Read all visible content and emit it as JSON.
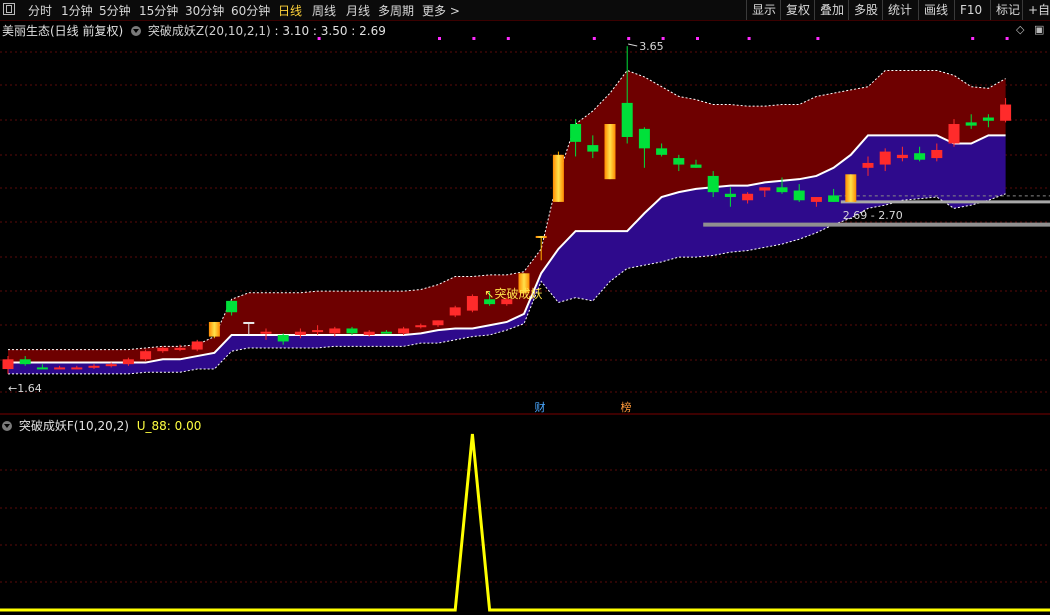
{
  "toolbar": {
    "periods": [
      "分时",
      "1分钟",
      "5分钟",
      "15分钟",
      "30分钟",
      "60分钟",
      "日线",
      "周线",
      "月线",
      "多周期",
      "更多 >"
    ],
    "active": "日线",
    "right_buttons": [
      "显示",
      "复权",
      "叠加",
      "多股",
      "统计",
      "画线",
      "F10",
      "标记",
      "+自选"
    ]
  },
  "main": {
    "stock_title": "美丽生态(日线 前复权)",
    "indicator_name": "突破成妖Z(20,10,2,1)",
    "indicator_values": ": 3.10 : 3.50 : 2.69",
    "max_label": "3.65",
    "min_label": "1.64",
    "range_label": "2.69 - 2.70",
    "signal_label": "突破成妖",
    "event_tags": [
      "财",
      "榜"
    ]
  },
  "sub": {
    "indicator_name": "突破成妖F(10,20,2)",
    "value_label": "U_88: 0.00"
  },
  "colors": {
    "up": "#ff2b2b",
    "down": "#00e03a",
    "highlight": "#ffb000",
    "upper_band": "#6e0000",
    "lower_band": "#2e0a8c",
    "mid_line": "#ffffff",
    "signal_line": "#ffff00"
  },
  "chart_data": [
    {
      "type": "candlestick",
      "price_range": [
        1.5,
        3.7
      ],
      "candles": [
        {
          "o": 1.66,
          "h": 1.74,
          "l": 1.63,
          "c": 1.72,
          "v": "up"
        },
        {
          "o": 1.72,
          "h": 1.74,
          "l": 1.68,
          "c": 1.69,
          "v": "down"
        },
        {
          "o": 1.67,
          "h": 1.69,
          "l": 1.66,
          "c": 1.66,
          "v": "down"
        },
        {
          "o": 1.67,
          "h": 1.68,
          "l": 1.66,
          "c": 1.67,
          "v": "up"
        },
        {
          "o": 1.67,
          "h": 1.68,
          "l": 1.66,
          "c": 1.67,
          "v": "up"
        },
        {
          "o": 1.67,
          "h": 1.69,
          "l": 1.66,
          "c": 1.68,
          "v": "up"
        },
        {
          "o": 1.68,
          "h": 1.7,
          "l": 1.67,
          "c": 1.69,
          "v": "up"
        },
        {
          "o": 1.69,
          "h": 1.73,
          "l": 1.68,
          "c": 1.72,
          "v": "up"
        },
        {
          "o": 1.72,
          "h": 1.78,
          "l": 1.71,
          "c": 1.77,
          "v": "up"
        },
        {
          "o": 1.77,
          "h": 1.8,
          "l": 1.76,
          "c": 1.79,
          "v": "up"
        },
        {
          "o": 1.79,
          "h": 1.81,
          "l": 1.77,
          "c": 1.78,
          "v": "up"
        },
        {
          "o": 1.78,
          "h": 1.84,
          "l": 1.77,
          "c": 1.83,
          "v": "up"
        },
        {
          "o": 1.86,
          "h": 1.95,
          "l": 1.85,
          "c": 1.95,
          "v": "limit"
        },
        {
          "o": 2.08,
          "h": 2.08,
          "l": 1.99,
          "c": 2.01,
          "v": "down"
        },
        {
          "o": 1.95,
          "h": 1.95,
          "l": 1.87,
          "c": 1.95,
          "v": "flat"
        },
        {
          "o": 1.88,
          "h": 1.91,
          "l": 1.84,
          "c": 1.89,
          "v": "up"
        },
        {
          "o": 1.87,
          "h": 1.88,
          "l": 1.81,
          "c": 1.83,
          "v": "down"
        },
        {
          "o": 1.87,
          "h": 1.91,
          "l": 1.85,
          "c": 1.89,
          "v": "up"
        },
        {
          "o": 1.89,
          "h": 1.93,
          "l": 1.87,
          "c": 1.9,
          "v": "up"
        },
        {
          "o": 1.88,
          "h": 1.92,
          "l": 1.86,
          "c": 1.91,
          "v": "up"
        },
        {
          "o": 1.91,
          "h": 1.92,
          "l": 1.87,
          "c": 1.88,
          "v": "down"
        },
        {
          "o": 1.87,
          "h": 1.9,
          "l": 1.86,
          "c": 1.89,
          "v": "up"
        },
        {
          "o": 1.89,
          "h": 1.9,
          "l": 1.88,
          "c": 1.88,
          "v": "down"
        },
        {
          "o": 1.88,
          "h": 1.92,
          "l": 1.87,
          "c": 1.91,
          "v": "up"
        },
        {
          "o": 1.92,
          "h": 1.94,
          "l": 1.91,
          "c": 1.93,
          "v": "up"
        },
        {
          "o": 1.93,
          "h": 1.96,
          "l": 1.92,
          "c": 1.96,
          "v": "up"
        },
        {
          "o": 1.99,
          "h": 2.05,
          "l": 1.98,
          "c": 2.04,
          "v": "up"
        },
        {
          "o": 2.02,
          "h": 2.12,
          "l": 2.01,
          "c": 2.11,
          "v": "up"
        },
        {
          "o": 2.09,
          "h": 2.14,
          "l": 2.05,
          "c": 2.06,
          "v": "down"
        },
        {
          "o": 2.06,
          "h": 2.1,
          "l": 2.05,
          "c": 2.09,
          "v": "up"
        },
        {
          "o": 2.13,
          "h": 2.25,
          "l": 2.12,
          "c": 2.25,
          "v": "limit"
        },
        {
          "o": 2.48,
          "h": 2.48,
          "l": 2.33,
          "c": 2.48,
          "v": "limit"
        },
        {
          "o": 2.69,
          "h": 3.0,
          "l": 2.69,
          "c": 2.98,
          "v": "limit"
        },
        {
          "o": 3.17,
          "h": 3.2,
          "l": 2.97,
          "c": 3.06,
          "v": "down"
        },
        {
          "o": 3.04,
          "h": 3.1,
          "l": 2.96,
          "c": 3.0,
          "v": "down"
        },
        {
          "o": 2.83,
          "h": 3.17,
          "l": 2.83,
          "c": 3.17,
          "v": "limit"
        },
        {
          "o": 3.3,
          "h": 3.65,
          "l": 3.05,
          "c": 3.09,
          "v": "down"
        },
        {
          "o": 3.14,
          "h": 3.15,
          "l": 2.9,
          "c": 3.02,
          "v": "down"
        },
        {
          "o": 3.02,
          "h": 3.05,
          "l": 2.97,
          "c": 2.98,
          "v": "down"
        },
        {
          "o": 2.96,
          "h": 2.98,
          "l": 2.88,
          "c": 2.92,
          "v": "down"
        },
        {
          "o": 2.92,
          "h": 2.95,
          "l": 2.9,
          "c": 2.9,
          "v": "down"
        },
        {
          "o": 2.85,
          "h": 2.88,
          "l": 2.72,
          "c": 2.75,
          "v": "down"
        },
        {
          "o": 2.74,
          "h": 2.78,
          "l": 2.66,
          "c": 2.72,
          "v": "down"
        },
        {
          "o": 2.7,
          "h": 2.75,
          "l": 2.68,
          "c": 2.74,
          "v": "up"
        },
        {
          "o": 2.76,
          "h": 2.78,
          "l": 2.72,
          "c": 2.78,
          "v": "up"
        },
        {
          "o": 2.78,
          "h": 2.84,
          "l": 2.74,
          "c": 2.75,
          "v": "down"
        },
        {
          "o": 2.76,
          "h": 2.8,
          "l": 2.69,
          "c": 2.7,
          "v": "down"
        },
        {
          "o": 2.69,
          "h": 2.72,
          "l": 2.66,
          "c": 2.72,
          "v": "up"
        },
        {
          "o": 2.69,
          "h": 2.77,
          "l": 2.69,
          "c": 2.73,
          "v": "down"
        },
        {
          "o": 2.69,
          "h": 2.86,
          "l": 2.69,
          "c": 2.86,
          "v": "limit"
        },
        {
          "o": 2.9,
          "h": 2.97,
          "l": 2.85,
          "c": 2.93,
          "v": "up"
        },
        {
          "o": 2.92,
          "h": 3.02,
          "l": 2.88,
          "c": 3.0,
          "v": "up"
        },
        {
          "o": 2.96,
          "h": 3.03,
          "l": 2.94,
          "c": 2.98,
          "v": "up"
        },
        {
          "o": 2.99,
          "h": 3.03,
          "l": 2.94,
          "c": 2.95,
          "v": "down"
        },
        {
          "o": 2.96,
          "h": 3.05,
          "l": 2.94,
          "c": 3.01,
          "v": "up"
        },
        {
          "o": 3.05,
          "h": 3.2,
          "l": 3.03,
          "c": 3.17,
          "v": "up"
        },
        {
          "o": 3.18,
          "h": 3.23,
          "l": 3.14,
          "c": 3.16,
          "v": "down"
        },
        {
          "o": 3.19,
          "h": 3.23,
          "l": 3.15,
          "c": 3.21,
          "v": "down"
        },
        {
          "o": 3.19,
          "h": 3.33,
          "l": 3.18,
          "c": 3.29,
          "v": "up"
        }
      ],
      "upper_band": [
        1.78,
        1.78,
        1.78,
        1.78,
        1.78,
        1.78,
        1.78,
        1.78,
        1.79,
        1.8,
        1.8,
        1.81,
        1.86,
        2.09,
        2.13,
        2.13,
        2.13,
        2.13,
        2.14,
        2.14,
        2.14,
        2.14,
        2.14,
        2.14,
        2.15,
        2.18,
        2.23,
        2.23,
        2.24,
        2.24,
        2.26,
        2.4,
        2.85,
        3.17,
        3.25,
        3.36,
        3.5,
        3.46,
        3.4,
        3.34,
        3.32,
        3.29,
        3.29,
        3.28,
        3.28,
        3.29,
        3.29,
        3.34,
        3.36,
        3.38,
        3.4,
        3.5,
        3.5,
        3.5,
        3.5,
        3.47,
        3.4,
        3.39,
        3.45
      ],
      "middle_line": [
        1.7,
        1.7,
        1.7,
        1.7,
        1.7,
        1.7,
        1.7,
        1.7,
        1.7,
        1.72,
        1.72,
        1.74,
        1.76,
        1.87,
        1.87,
        1.87,
        1.87,
        1.87,
        1.87,
        1.87,
        1.87,
        1.87,
        1.87,
        1.87,
        1.88,
        1.9,
        1.91,
        1.91,
        1.93,
        1.95,
        2.0,
        2.25,
        2.4,
        2.51,
        2.51,
        2.51,
        2.51,
        2.62,
        2.72,
        2.75,
        2.77,
        2.78,
        2.79,
        2.79,
        2.81,
        2.82,
        2.83,
        2.85,
        2.9,
        2.98,
        3.1,
        3.1,
        3.1,
        3.1,
        3.1,
        3.05,
        3.05,
        3.1,
        3.1
      ],
      "lower_band": [
        1.63,
        1.63,
        1.63,
        1.63,
        1.63,
        1.63,
        1.63,
        1.63,
        1.64,
        1.64,
        1.64,
        1.66,
        1.66,
        1.77,
        1.79,
        1.79,
        1.79,
        1.79,
        1.79,
        1.8,
        1.8,
        1.8,
        1.8,
        1.8,
        1.82,
        1.82,
        1.84,
        1.86,
        1.87,
        1.9,
        1.94,
        2.2,
        2.07,
        2.1,
        2.08,
        2.2,
        2.28,
        2.3,
        2.32,
        2.35,
        2.35,
        2.36,
        2.38,
        2.39,
        2.41,
        2.43,
        2.46,
        2.5,
        2.55,
        2.59,
        2.65,
        2.67,
        2.7,
        2.71,
        2.72,
        2.65,
        2.67,
        2.7,
        2.74
      ],
      "support_lines": [
        2.55,
        2.69
      ],
      "signal_index": 27
    },
    {
      "type": "line",
      "name": "U_88",
      "ylim": [
        0,
        1
      ],
      "values": [
        0,
        0,
        0,
        0,
        0,
        0,
        0,
        0,
        0,
        0,
        0,
        0,
        0,
        0,
        0,
        0,
        0,
        0,
        0,
        0,
        0,
        0,
        0,
        0,
        0,
        0,
        0,
        1,
        0,
        0,
        0,
        0,
        0,
        0,
        0,
        0,
        0,
        0,
        0,
        0,
        0,
        0,
        0,
        0,
        0,
        0,
        0,
        0,
        0,
        0,
        0,
        0,
        0,
        0,
        0,
        0,
        0,
        0,
        0
      ]
    }
  ]
}
